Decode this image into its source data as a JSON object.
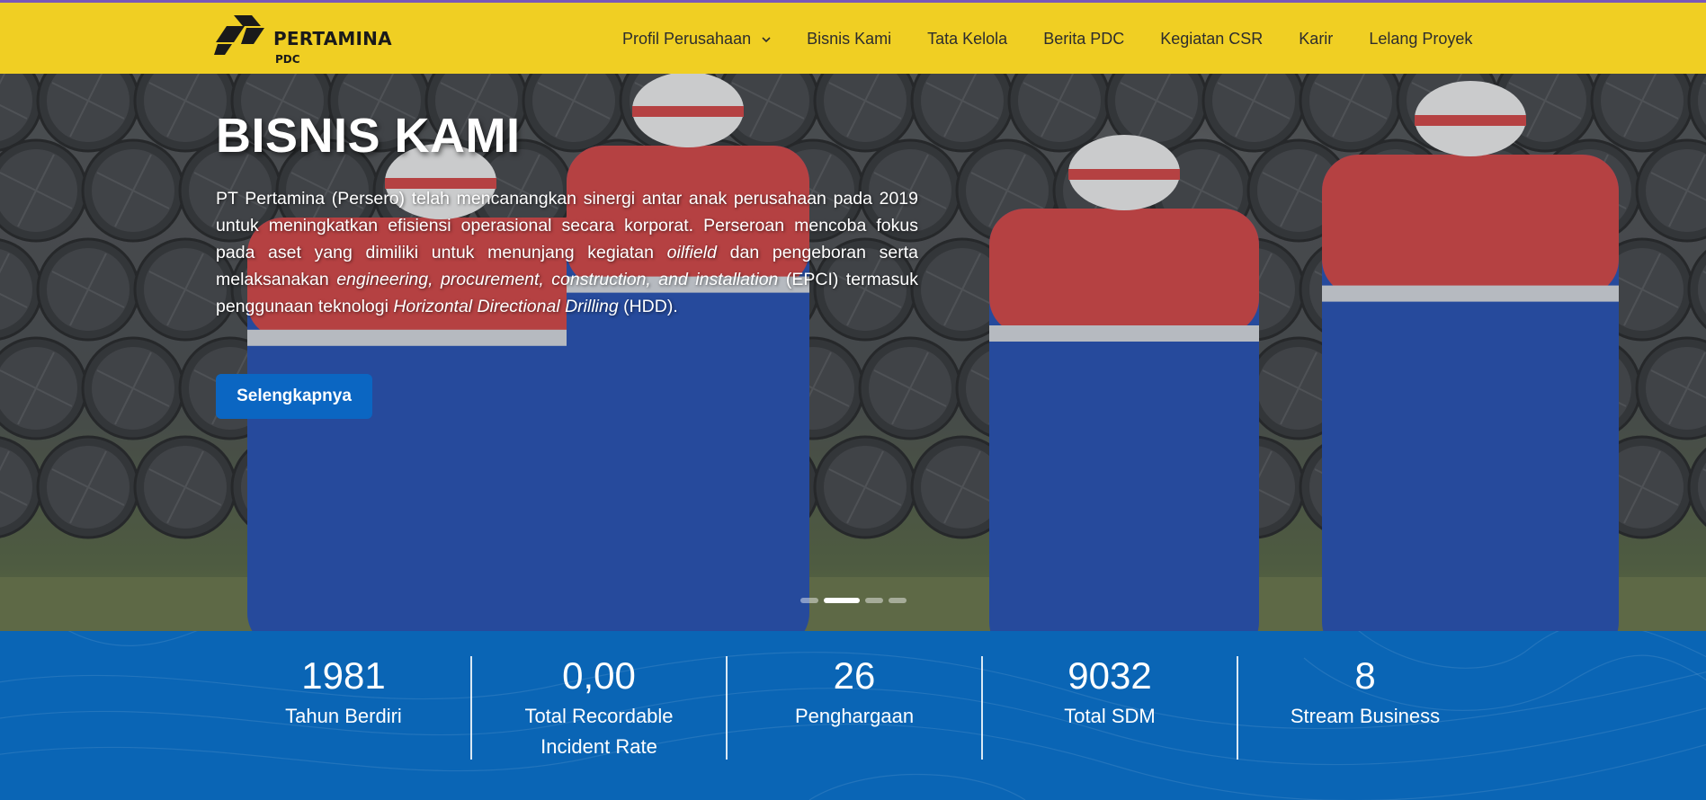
{
  "brand": {
    "name": "PERTAMINA",
    "sub": "PDC"
  },
  "nav": {
    "items": [
      {
        "label": "Profil Perusahaan",
        "dropdown": true
      },
      {
        "label": "Bisnis Kami"
      },
      {
        "label": "Tata Kelola"
      },
      {
        "label": "Berita PDC"
      },
      {
        "label": "Kegiatan CSR"
      },
      {
        "label": "Karir"
      },
      {
        "label": "Lelang Proyek"
      }
    ]
  },
  "hero": {
    "title": "BISNIS KAMI",
    "desc_parts": [
      {
        "t": "PT Pertamina (Persero) telah mencanangkan sinergi antar anak perusahaan pada 2019 untuk meningkatkan efisiensi operasional secara korporat. Perseroan mencoba fokus pada aset yang dimiliki untuk menunjang kegiatan ",
        "i": false
      },
      {
        "t": "oilfield",
        "i": true
      },
      {
        "t": " dan pengeboran serta melaksanakan ",
        "i": false
      },
      {
        "t": "engineering, procurement, construction, and installation",
        "i": true
      },
      {
        "t": " (EPCI) termasuk penggunaan teknologi ",
        "i": false
      },
      {
        "t": "Horizontal Directional Drilling",
        "i": true
      },
      {
        "t": " (HDD).",
        "i": false
      }
    ],
    "button_label": "Selengkapnya",
    "slides": {
      "count": 4,
      "active": 2
    }
  },
  "stats": [
    {
      "value": "1981",
      "label": "Tahun Berdiri"
    },
    {
      "value": "0,00",
      "label": "Total Recordable Incident Rate"
    },
    {
      "value": "26",
      "label": "Penghargaan"
    },
    {
      "value": "9032",
      "label": "Total SDM"
    },
    {
      "value": "8",
      "label": "Stream Business"
    }
  ],
  "colors": {
    "nav_bg": "#f0cf23",
    "primary": "#0b66c2",
    "stats_bg": "#0a65b5"
  }
}
